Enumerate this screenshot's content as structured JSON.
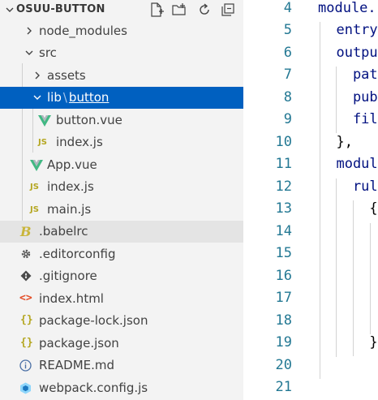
{
  "explorer": {
    "title": "OSUU-BUTTON",
    "actions": [
      "new-file-icon",
      "new-folder-icon",
      "refresh-icon",
      "collapse-all-icon"
    ],
    "items": {
      "node_modules": "node_modules",
      "src": "src",
      "assets": "assets",
      "lib": "lib",
      "lib_sep": "\\",
      "button_folder": "button",
      "button_vue": "button.vue",
      "index_js_inner": "index.js",
      "app_vue": "App.vue",
      "index_js": "index.js",
      "main_js": "main.js",
      "babelrc": ".babelrc",
      "editorconfig": ".editorconfig",
      "gitignore": ".gitignore",
      "index_html": "index.html",
      "package_lock": "package-lock.json",
      "package_json": "package.json",
      "readme": "README.md",
      "webpack": "webpack.config.js"
    },
    "js_badge": "JS",
    "json_badge": "{}",
    "html_badge": "<>"
  },
  "editor": {
    "line_numbers": [
      "4",
      "5",
      "6",
      "7",
      "8",
      "9",
      "10",
      "11",
      "12",
      "13",
      "14",
      "15",
      "16",
      "17",
      "18",
      "19",
      "20",
      "21"
    ],
    "lines": [
      "module.",
      "  entry",
      "  outpu",
      "    pat",
      "    pub",
      "    fil",
      "  },",
      "  modul",
      "    rul",
      "      {",
      "",
      "",
      "",
      "",
      "",
      "      }",
      "",
      ""
    ]
  },
  "colors": {
    "selection": "#0060c0",
    "vue_green": "#41b883",
    "js_yellow": "#b5a722",
    "line_number": "#237893"
  }
}
